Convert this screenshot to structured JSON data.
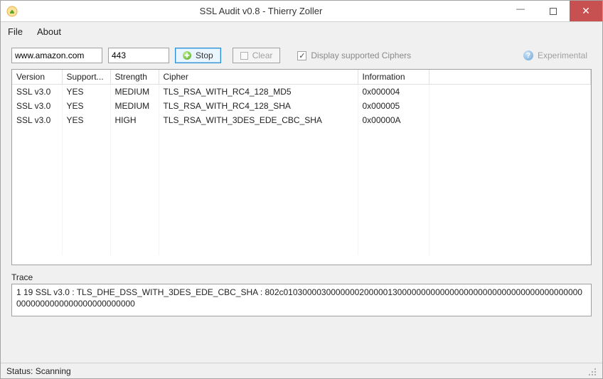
{
  "window": {
    "title": "SSL Audit v0.8  - Thierry Zoller"
  },
  "menu": {
    "file": "File",
    "about": "About"
  },
  "toolbar": {
    "host": "www.amazon.com",
    "port": "443",
    "stop_label": "Stop",
    "clear_label": "Clear",
    "display_ciphers_label": "Display supported Ciphers",
    "display_ciphers_checked": true,
    "experimental_label": "Experimental"
  },
  "table": {
    "headers": {
      "version": "Version",
      "supported": "Support...",
      "strength": "Strength",
      "cipher": "Cipher",
      "information": "Information"
    },
    "rows": [
      {
        "version": "SSL v3.0",
        "supported": "YES",
        "strength": "MEDIUM",
        "cipher": "TLS_RSA_WITH_RC4_128_MD5",
        "information": "0x000004"
      },
      {
        "version": "SSL v3.0",
        "supported": "YES",
        "strength": "MEDIUM",
        "cipher": "TLS_RSA_WITH_RC4_128_SHA",
        "information": "0x000005"
      },
      {
        "version": "SSL v3.0",
        "supported": "YES",
        "strength": "HIGH",
        "cipher": "TLS_RSA_WITH_3DES_EDE_CBC_SHA",
        "information": "0x00000A"
      }
    ]
  },
  "trace": {
    "label": "Trace",
    "content": "1 19 SSL v3.0 : TLS_DHE_DSS_WITH_3DES_EDE_CBC_SHA : 802c0103000030000000200000130000000000000000000000000000000000000000000000000000000000000000"
  },
  "status": {
    "text": "Status: Scanning"
  }
}
